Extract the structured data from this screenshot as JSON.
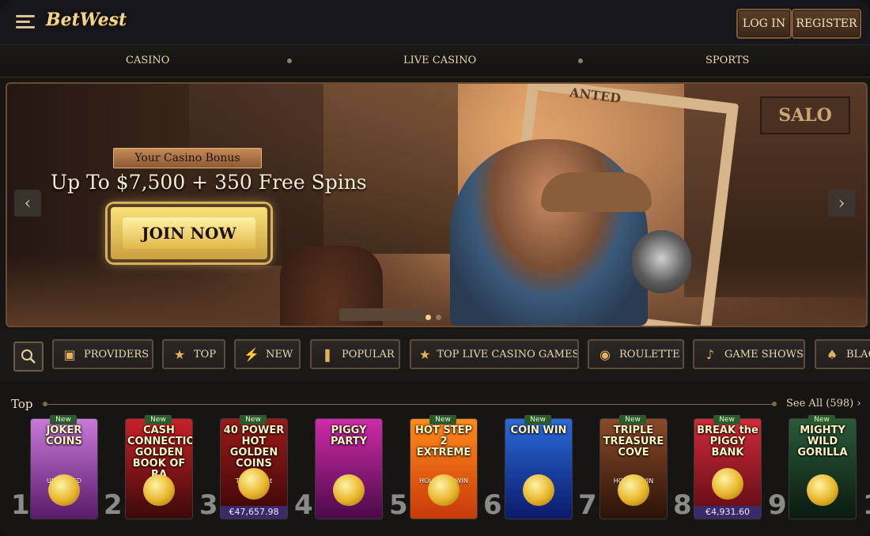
{
  "header": {
    "logo": "BetWest",
    "login": "LOG IN",
    "register": "REGISTER"
  },
  "nav": {
    "items": [
      "CASINO",
      "LIVE CASINO",
      "SPORTS"
    ]
  },
  "banner": {
    "bonus_tag": "Your Casino Bonus",
    "headline": "Up To $7,500 + 350 Free Spins",
    "cta": "JOIN NOW",
    "sign": "SALO",
    "wanted": "ANTED",
    "prev_icon": "chevron-left-icon",
    "next_icon": "chevron-right-icon"
  },
  "categories": [
    {
      "label": "PROVIDERS",
      "icon": "book-icon"
    },
    {
      "label": "TOP",
      "icon": "star-icon"
    },
    {
      "label": "NEW",
      "icon": "lightning-icon"
    },
    {
      "label": "POPULAR",
      "icon": "dynamite-icon"
    },
    {
      "label": "TOP LIVE CASINO GAMES",
      "icon": "star-icon"
    },
    {
      "label": "ROULETTE",
      "icon": "roulette-icon"
    },
    {
      "label": "GAME SHOWS",
      "icon": "microphone-icon"
    },
    {
      "label": "BLAC",
      "icon": "cards-icon"
    }
  ],
  "top_section": {
    "title": "Top",
    "see_all": "See All (598)"
  },
  "games": [
    {
      "rank": "1",
      "name": "JOKER COINS",
      "sub": "UNLIMITED FORTUNE",
      "badge": "New",
      "jackpot": "",
      "colors": [
        "#c77ad8",
        "#5a1a6a"
      ]
    },
    {
      "rank": "2",
      "name": "CASH CONNECTION GOLDEN BOOK OF RA",
      "sub": "",
      "badge": "New",
      "jackpot": "",
      "colors": [
        "#c8202a",
        "#3a0a0a"
      ]
    },
    {
      "rank": "3",
      "name": "40 POWER HOT GOLDEN COINS",
      "sub": "Triple Boost",
      "badge": "New",
      "jackpot": "€47,657.98",
      "colors": [
        "#9a1a1a",
        "#3a0606"
      ]
    },
    {
      "rank": "4",
      "name": "PIGGY PARTY",
      "sub": "",
      "badge": "",
      "jackpot": "",
      "colors": [
        "#d02aa8",
        "#4a0a4a"
      ]
    },
    {
      "rank": "5",
      "name": "HOT STEP 2 EXTREME",
      "sub": "HOLD AND WIN",
      "badge": "New",
      "jackpot": "",
      "colors": [
        "#ff8a1a",
        "#c83a0a"
      ]
    },
    {
      "rank": "6",
      "name": "COIN WIN",
      "sub": "",
      "badge": "New",
      "jackpot": "",
      "colors": [
        "#2a6ad8",
        "#0a1a6a"
      ]
    },
    {
      "rank": "7",
      "name": "TRIPLE TREASURE COVE",
      "sub": "HOLD & WIN",
      "badge": "New",
      "jackpot": "",
      "colors": [
        "#8a4a2a",
        "#2a1206"
      ]
    },
    {
      "rank": "8",
      "name": "BREAK the PIGGY BANK",
      "sub": "",
      "badge": "New",
      "jackpot": "€4,931.60",
      "colors": [
        "#d02a3a",
        "#5a0a14"
      ]
    },
    {
      "rank": "9",
      "name": "MIGHTY WILD GORILLA",
      "sub": "",
      "badge": "New",
      "jackpot": "",
      "colors": [
        "#2a5a3a",
        "#0a1a10"
      ]
    },
    {
      "rank": "1",
      "name": "",
      "sub": "",
      "badge": "",
      "jackpot": "",
      "colors": [
        "#2a2a2a",
        "#111111"
      ]
    }
  ]
}
